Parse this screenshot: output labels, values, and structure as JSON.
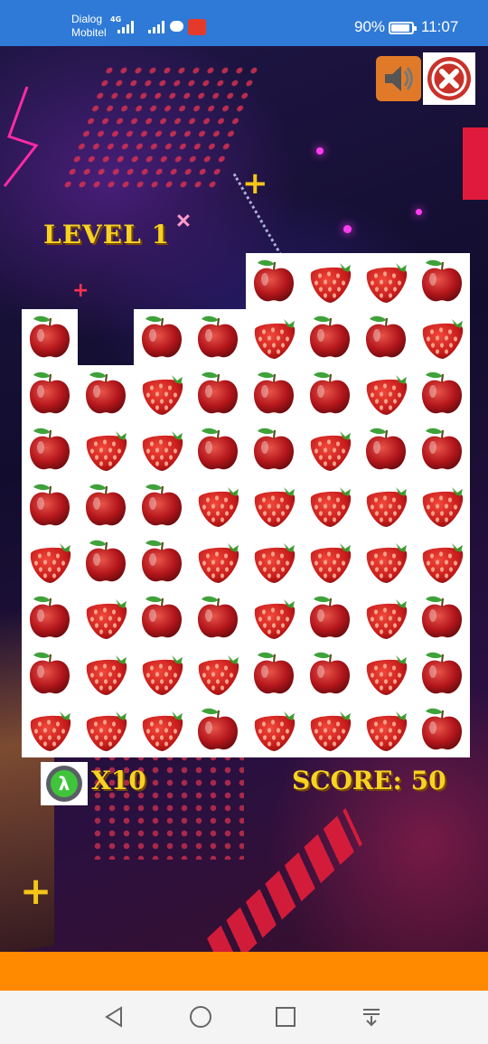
{
  "status_bar": {
    "carrier_line1": "Dialog",
    "carrier_line2": "Mobitel",
    "network": "4G",
    "battery_percent": "90%",
    "battery_level": 0.9,
    "time": "11:07"
  },
  "game": {
    "level_label": "LEVEL 1",
    "hint_count": "X10",
    "score_label": "SCORE: 50",
    "sound_icon": "speaker-icon",
    "close_icon": "close-icon",
    "hint_icon": "lambda-icon"
  },
  "board": {
    "rows": [
      [
        "",
        "",
        "",
        "",
        "A",
        "S",
        "S",
        "A"
      ],
      [
        "A",
        "",
        "A",
        "A",
        "S",
        "A",
        "A",
        "S"
      ],
      [
        "A",
        "A",
        "S",
        "A",
        "A",
        "A",
        "S",
        "A"
      ],
      [
        "A",
        "S",
        "S",
        "A",
        "A",
        "S",
        "A",
        "A"
      ],
      [
        "A",
        "A",
        "A",
        "S",
        "S",
        "S",
        "S",
        "S"
      ],
      [
        "S",
        "A",
        "A",
        "S",
        "S",
        "S",
        "S",
        "S"
      ],
      [
        "A",
        "S",
        "A",
        "A",
        "S",
        "A",
        "S",
        "A"
      ],
      [
        "A",
        "S",
        "S",
        "S",
        "A",
        "A",
        "S",
        "A"
      ],
      [
        "S",
        "S",
        "S",
        "A",
        "S",
        "S",
        "S",
        "A"
      ]
    ],
    "legend": {
      "A": "apple",
      "S": "strawberry"
    }
  },
  "colors": {
    "status_bar": "#2f7ad6",
    "text_gold": "#f7d321",
    "banner": "#ff8a00",
    "nav_bar": "#f4f4f4"
  }
}
